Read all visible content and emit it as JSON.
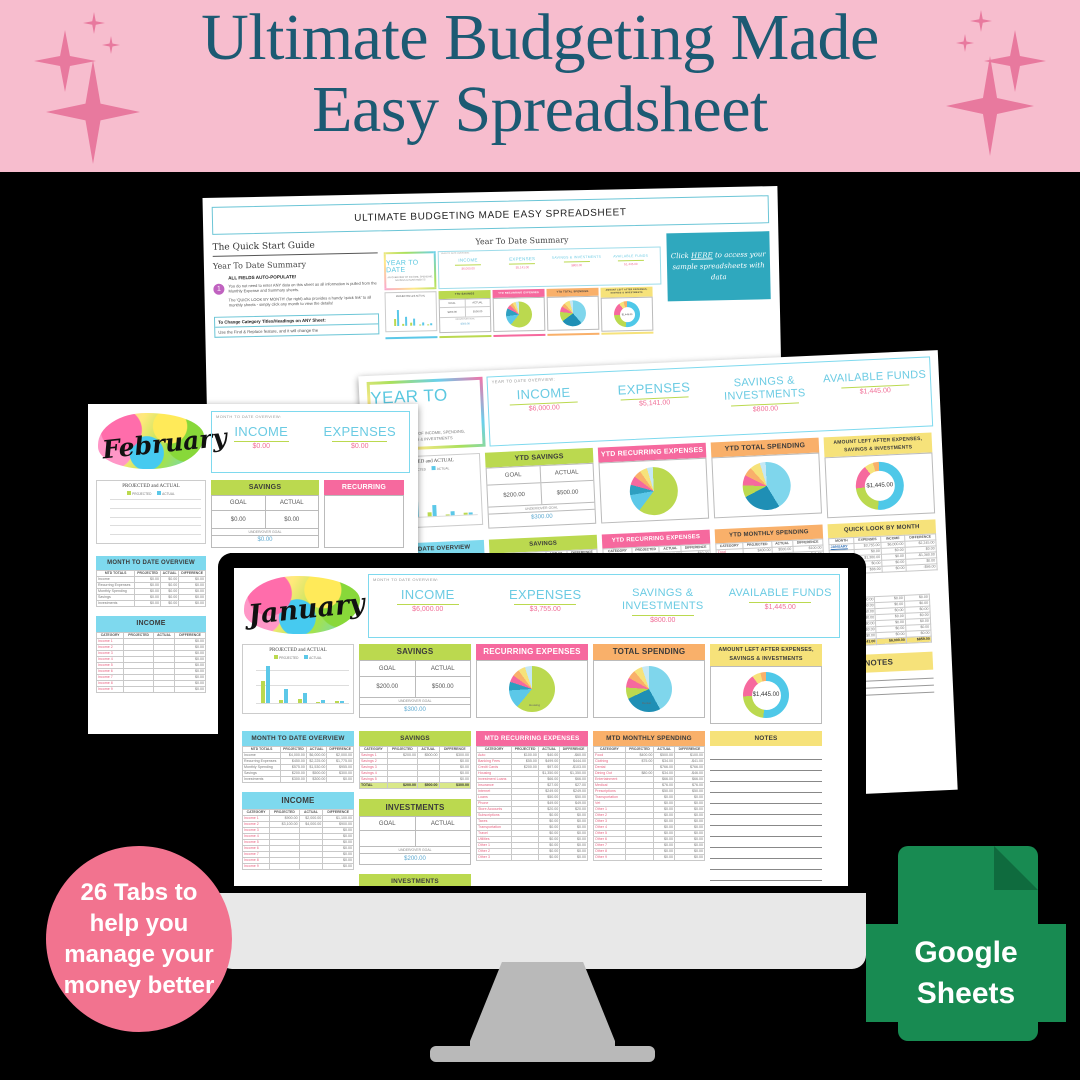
{
  "banner": {
    "title_line1": "Ultimate Budgeting Made",
    "title_line2": "Easy Spreadsheet",
    "bg_color": "#F7BDCE",
    "text_color": "#1C5A73",
    "sparkle_color": "#E8799E"
  },
  "badges": {
    "tabs_text": "26 Tabs to help you manage your money better",
    "tabs_bg": "#F2738F",
    "google_sheets_line1": "Google",
    "google_sheets_line2": "Sheets",
    "google_sheets_bg": "#188B52"
  },
  "quick_start": {
    "doc_title": "ULTIMATE BUDGETING MADE EASY SPREADSHEET",
    "heading": "The Quick Start Guide",
    "subheading": "Year To Date Summary",
    "step_number": "1",
    "bold_lead": "ALL FIELDS AUTO-POPULATE!",
    "para1": "You do not need to enter ANY data on this sheet as all information is pulled from the Monthly Expense and Summary sheets.",
    "para2": "The 'QUICK LOOK BY MONTH' (far right) also provides a handy 'quick link' to all monthly sheets - simply click any month to view the details!",
    "note_title": "To Change Category Titles/Headings on ANY Sheet:",
    "note_body": "Use the Find & Replace feature, and it will change the",
    "preview_caption": "Year To Date Summary",
    "callout_pre": "Click ",
    "callout_link": "HERE",
    "callout_post": " to access your sample spreadsheets with data",
    "callout_bg": "#2FA8BE"
  },
  "ytd_sheet": {
    "logo_title": "YEAR TO DATE",
    "logo_sub": "AN OVERVIEW OF INCOME, SPENDING, SAVINGS & INVESTMENTS",
    "overview_label": "YEAR TO DATE  OVERVIEW:",
    "kpis": [
      {
        "label": "INCOME",
        "value": "$6,000.00"
      },
      {
        "label": "EXPENSES",
        "value": "$5,141.00"
      },
      {
        "label": "SAVINGS & INVESTMENTS",
        "value": "$800.00"
      },
      {
        "label": "AVAILABLE FUNDS",
        "value": "$1,445.00"
      }
    ],
    "chart_title": "PROJECTED and ACTUAL",
    "legend": [
      "PROJECTED",
      "ACTUAL"
    ],
    "cards": [
      {
        "title": "YTD SAVINGS",
        "color": "#BBD94F"
      },
      {
        "title": "YTD RECURRING  EXPENSES",
        "color": "#F6699E"
      },
      {
        "title": "YTD TOTAL SPENDING",
        "color": "#F9B06A"
      },
      {
        "title": "AMOUNT LEFT AFTER EXPENSES, SAVINGS & INVESTMENTS",
        "color": "#F6E27A"
      }
    ],
    "savings_goal_label": "GOAL",
    "savings_actual_label": "ACTUAL",
    "savings_goal": "$200.00",
    "savings_actual": "$500.00",
    "under_over_label": "UNDER/OVER GOAL",
    "under_over_value": "$300.00",
    "donut_center": "$1,445.00",
    "tables": [
      {
        "title": "YEAR TO DATE OVERVIEW",
        "color": "#7ED9EE",
        "headers": [
          "YTD TOTALS",
          "PROJECTED",
          "ACTUAL",
          "DIFFERENCE"
        ]
      },
      {
        "title": "SAVINGS",
        "color": "#BBD94F",
        "headers": [
          "CATEGORY",
          "PROJECTED",
          "ACTUAL",
          "DIFFERENCE"
        ]
      },
      {
        "title": "YTD RECURRING  EXPENSES",
        "color": "#F6699E",
        "headers": [
          "CATEGORY",
          "PROJECTED",
          "ACTUAL",
          "DIFFERENCE"
        ]
      },
      {
        "title": "YTD MONTHLY SPENDING",
        "color": "#F9B06A",
        "headers": [
          "CATEGORY",
          "PROJECTED",
          "ACTUAL",
          "DIFFERENCE"
        ]
      },
      {
        "title": "QUICK LOOK BY MONTH",
        "color": "#F6E27A",
        "headers": [
          "MONTH",
          "EXPENSES",
          "INCOME",
          "DIFFERENCE"
        ]
      }
    ],
    "quick_look_rows": [
      [
        "JANUARY",
        "$3,755.00",
        "$6,000.00",
        "$2,245.00"
      ],
      [
        "",
        "$0.00",
        "$0.00",
        "$0.00"
      ],
      [
        "",
        "$1,380.00",
        "$0.00",
        "-$1,380.00"
      ],
      [
        "",
        "$0.00",
        "$0.00",
        "$0.00"
      ],
      [
        "",
        "$86.00",
        "$0.00",
        "-$86.00"
      ],
      [
        "",
        "$0.00",
        "$0.00",
        "$0.00"
      ],
      [
        "",
        "$0.00",
        "$0.00",
        "$0.00"
      ],
      [
        "",
        "$0.00",
        "$0.00",
        "$0.00"
      ],
      [
        "",
        "$0.00",
        "$0.00",
        "$0.00"
      ],
      [
        "",
        "$0.00",
        "$0.00",
        "$0.00"
      ],
      [
        "",
        "$0.00",
        "$0.00",
        "$0.00"
      ],
      [
        "",
        "$0.00",
        "$0.00",
        "$0.00"
      ]
    ],
    "quick_look_total": [
      "TOTAL",
      "$5,141.00",
      "$6,000.00",
      "$859.00"
    ],
    "notes_title": "NOTES"
  },
  "january_sheet": {
    "month": "January",
    "overview_label": "MONTH  TO  DATE  OVERVIEW:",
    "kpis": [
      {
        "label": "INCOME",
        "value": "$6,000.00"
      },
      {
        "label": "EXPENSES",
        "value": "$3,755.00"
      },
      {
        "label": "SAVINGS & INVESTMENTS",
        "value": "$800.00"
      },
      {
        "label": "AVAILABLE FUNDS",
        "value": "$1,445.00"
      }
    ],
    "chart_title": "PROJECTED and ACTUAL",
    "legend": [
      "PROJECTED",
      "ACTUAL"
    ],
    "cards": [
      {
        "title": "SAVINGS",
        "color": "#BBD94F"
      },
      {
        "title": "RECURRING  EXPENSES",
        "color": "#F6699E"
      },
      {
        "title": "TOTAL SPENDING",
        "color": "#F9B06A"
      },
      {
        "title": "AMOUNT LEFT AFTER EXPENSES, SAVINGS & INVESTMENTS",
        "color": "#F6E27A"
      }
    ],
    "savings_goal_label": "GOAL",
    "savings_actual_label": "ACTUAL",
    "savings_goal": "$200.00",
    "savings_actual": "$500.00",
    "under_over_label": "UNDER/OVER GOAL",
    "under_over_value": "$300.00",
    "donut_center": "$1,445.00",
    "pie_labels": [
      "Housing",
      "Food",
      "Dental",
      "Credit Card",
      "Parking Fee"
    ],
    "tables": [
      {
        "title": "MONTH TO DATE OVERVIEW",
        "color": "#7ED9EE",
        "headers": [
          "MTD TOTALS",
          "PROJECTED",
          "ACTUAL",
          "DIFFERENCE"
        ]
      },
      {
        "title": "SAVINGS",
        "color": "#BBD94F",
        "headers": [
          "CATEGORY",
          "PROJECTED",
          "ACTUAL",
          "DIFFERENCE"
        ]
      },
      {
        "title": "MTD RECURRING  EXPENSES",
        "color": "#F6699E",
        "headers": [
          "CATEGORY",
          "PROJECTED",
          "ACTUAL",
          "DIFFERENCE"
        ]
      },
      {
        "title": "MTD MONTHLY SPENDING",
        "color": "#F9B06A",
        "headers": [
          "CATEGORY",
          "PROJECTED",
          "ACTUAL",
          "DIFFERENCE"
        ]
      },
      {
        "title": "NOTES",
        "color": "#F6E27A",
        "headers": []
      }
    ],
    "mtd_overview_rows": [
      [
        "Income",
        "$4,000.00",
        "$6,000.00",
        "$2,000.00"
      ],
      [
        "Recurring Expenses",
        "$450.00",
        "$2,225.00",
        "$1,775.00"
      ],
      [
        "Monthly Spending",
        "$575.00",
        "$1,530.00",
        "$955.00"
      ],
      [
        "Savings",
        "$200.00",
        "$500.00",
        "$300.00"
      ],
      [
        "Investments",
        "$300.00",
        "$300.00",
        "$0.00"
      ]
    ],
    "income_title": "INCOME",
    "income_headers": [
      "CATEGORY",
      "PROJECTED",
      "ACTUAL",
      "DIFFERENCE"
    ],
    "income_rows": [
      [
        "Income 1",
        "$900.00",
        "$2,000.00",
        "$1,100.00"
      ],
      [
        "Income 2",
        "$3,100.00",
        "$4,000.00",
        "$900.00"
      ],
      [
        "Income 3",
        "",
        "",
        "$0.00"
      ],
      [
        "Income 4",
        "",
        "",
        "$0.00"
      ],
      [
        "Income 5",
        "",
        "",
        "$0.00"
      ],
      [
        "Income 6",
        "",
        "",
        "$0.00"
      ],
      [
        "Income 7",
        "",
        "",
        "$0.00"
      ],
      [
        "Income 8",
        "",
        "",
        "$0.00"
      ],
      [
        "Income 9",
        "",
        "",
        "$0.00"
      ]
    ],
    "savings_rows": [
      [
        "Savings 1",
        "$200.00",
        "$500.00",
        "$300.00"
      ],
      [
        "Savings 2",
        "",
        "",
        "$0.00"
      ],
      [
        "Savings 3",
        "",
        "",
        "$0.00"
      ],
      [
        "Savings 4",
        "",
        "",
        "$0.00"
      ],
      [
        "Savings 5",
        "",
        "",
        "$0.00"
      ]
    ],
    "savings_total_row": [
      "TOTAL",
      "$200.00",
      "$500.00",
      "$300.00"
    ],
    "investments_title": "INVESTMENTS",
    "investments_goal_label": "GOAL",
    "investments_actual_label": "ACTUAL",
    "investments_under_label": "UNDER/OVER GOAL",
    "investments_under_value": "$200.00",
    "investments_table_title": "INVESTMENTS",
    "recurring_rows": [
      [
        "Auto",
        "$100.00",
        "$40.00",
        "-$60.00"
      ],
      [
        "Banking Fees",
        "$55.00",
        "$499.00",
        "$444.00"
      ],
      [
        "Credit Cards",
        "$200.00",
        "$97.00",
        "-$103.00"
      ],
      [
        "Housing",
        "",
        "$1,350.00",
        "$1,350.00"
      ],
      [
        "Investment Loans",
        "",
        "$66.00",
        "$66.00"
      ],
      [
        "Insurance",
        "",
        "$27.00",
        "$27.00"
      ],
      [
        "Internet",
        "",
        "$249.00",
        "$249.00"
      ],
      [
        "Loans",
        "",
        "$50.00",
        "$50.00"
      ],
      [
        "Phone",
        "",
        "$49.00",
        "$49.00"
      ],
      [
        "Store Accounts",
        "",
        "$20.00",
        "$20.00"
      ],
      [
        "Subscriptions",
        "",
        "$0.00",
        "$0.00"
      ],
      [
        "Taxes",
        "",
        "$0.00",
        "$0.00"
      ],
      [
        "Transportation",
        "",
        "$0.00",
        "$0.00"
      ],
      [
        "Travel",
        "",
        "$0.00",
        "$0.00"
      ],
      [
        "Utilities",
        "",
        "$0.00",
        "$0.00"
      ],
      [
        "Other 1",
        "",
        "$0.00",
        "$0.00"
      ],
      [
        "Other 2",
        "",
        "$0.00",
        "$0.00"
      ],
      [
        "Other 3",
        "",
        "$0.00",
        "$0.00"
      ]
    ],
    "spending_rows": [
      [
        "Food",
        "$400.00",
        "$500.00",
        "$100.00"
      ],
      [
        "Clothing",
        "$75.00",
        "$34.00",
        "-$41.00"
      ],
      [
        "Dental",
        "",
        "$766.00",
        "$766.00"
      ],
      [
        "Dining Out",
        "$80.00",
        "$34.00",
        "-$46.00"
      ],
      [
        "Entertainment",
        "",
        "$66.00",
        "$66.00"
      ],
      [
        "Medical",
        "",
        "$76.00",
        "$76.00"
      ],
      [
        "Prescriptions",
        "",
        "$50.00",
        "$50.00"
      ],
      [
        "Transportation",
        "",
        "$0.00",
        "$0.00"
      ],
      [
        "Vet",
        "",
        "$0.00",
        "$0.00"
      ],
      [
        "Other 1",
        "",
        "$0.00",
        "$0.00"
      ],
      [
        "Other 2",
        "",
        "$0.00",
        "$0.00"
      ],
      [
        "Other 3",
        "",
        "$0.00",
        "$0.00"
      ],
      [
        "Other 4",
        "",
        "$0.00",
        "$0.00"
      ],
      [
        "Other 5",
        "",
        "$0.00",
        "$0.00"
      ],
      [
        "Other 6",
        "",
        "$0.00",
        "$0.00"
      ],
      [
        "Other 7",
        "",
        "$0.00",
        "$0.00"
      ],
      [
        "Other 8",
        "",
        "$0.00",
        "$0.00"
      ],
      [
        "Other 9",
        "",
        "$0.00",
        "$0.00"
      ]
    ]
  },
  "february_sheet": {
    "month": "February",
    "overview_label": "MONTH  TO  DATE  OVERVIEW:",
    "kpis": [
      {
        "label": "INCOME",
        "value": "$0.00"
      },
      {
        "label": "EXPENSES",
        "value": "$0.00"
      }
    ],
    "chart_title": "PROJECTED and ACTUAL",
    "legend": [
      "PROJECTED",
      "ACTUAL"
    ],
    "savings_title": "SAVINGS",
    "recurring_title": "RECURRING",
    "savings_goal_label": "GOAL",
    "savings_actual_label": "ACTUAL",
    "savings_goal": "$0.00",
    "savings_actual": "$0.00",
    "under_over_label": "UNDER/OVER GOAL",
    "under_over_value": "$0.00",
    "overview_table_title": "MONTH TO DATE OVERVIEW",
    "overview_headers": [
      "MTD TOTALS",
      "PROJECTED",
      "ACTUAL",
      "DIFFERENCE"
    ],
    "overview_rows": [
      [
        "Income",
        "$0.00",
        "$0.00",
        "$0.00"
      ],
      [
        "Recurring Expenses",
        "$0.00",
        "$0.00",
        "$0.00"
      ],
      [
        "Monthly Spending",
        "$0.00",
        "$0.00",
        "$0.00"
      ],
      [
        "Savings",
        "$0.00",
        "$0.00",
        "$0.00"
      ],
      [
        "Investments",
        "$0.00",
        "$0.00",
        "$0.00"
      ]
    ],
    "income_title": "INCOME",
    "income_headers": [
      "CATEGORY",
      "PROJECTED",
      "ACTUAL",
      "DIFFERENCE"
    ],
    "income_rows": [
      [
        "Income 1",
        "",
        "",
        "$0.00"
      ],
      [
        "Income 2",
        "",
        "",
        "$0.00"
      ],
      [
        "Income 3",
        "",
        "",
        "$0.00"
      ],
      [
        "Income 4",
        "",
        "",
        "$0.00"
      ],
      [
        "Income 5",
        "",
        "",
        "$0.00"
      ],
      [
        "Income 6",
        "",
        "",
        "$0.00"
      ],
      [
        "Income 7",
        "",
        "",
        "$0.00"
      ],
      [
        "Income 8",
        "",
        "",
        "$0.00"
      ],
      [
        "Income 9",
        "",
        "",
        "$0.00"
      ]
    ]
  },
  "chart_data": [
    {
      "type": "bar",
      "title": "PROJECTED and ACTUAL",
      "categories": [
        "Income",
        "Recurring Expenses",
        "Monthly Spending",
        "Savings",
        "Investments"
      ],
      "series": [
        {
          "name": "PROJECTED",
          "values": [
            4000,
            450,
            575,
            200,
            300
          ]
        },
        {
          "name": "ACTUAL",
          "values": [
            6000,
            2225,
            1530,
            500,
            300
          ]
        }
      ],
      "ylabel": "",
      "xlabel": "",
      "ylim": [
        0,
        6000
      ],
      "legend_position": "top",
      "colors": [
        "#BBD94F",
        "#5CC8E8"
      ]
    },
    {
      "type": "pie",
      "title": "RECURRING  EXPENSES",
      "categories": [
        "Housing",
        "Credit Cards",
        "Banking Fees",
        "Auto",
        "Insurance",
        "Internet",
        "Investment Loans",
        "Phone"
      ],
      "values": [
        60.7,
        12.2,
        10.1,
        4.4,
        3.7,
        3.1,
        3.0,
        2.8
      ],
      "colors": [
        "#BBD94F",
        "#5CC8E8",
        "#2E9FC0",
        "#F6699E",
        "#F9B06A",
        "#F6E27A",
        "#C5E8F5",
        "#E8E8E8"
      ]
    },
    {
      "type": "pie",
      "title": "TOTAL SPENDING",
      "categories": [
        "Dental",
        "Food",
        "Clothing",
        "Dining Out",
        "Entertainment",
        "Medical",
        "Prescriptions",
        "Other"
      ],
      "values": [
        39.0,
        26.0,
        12.0,
        7.0,
        5.0,
        4.0,
        4.0,
        3.0
      ],
      "colors": [
        "#7FD6EC",
        "#1F8FB5",
        "#BBD94F",
        "#F6699E",
        "#F9B06A",
        "#F6E27A",
        "#C5E8F5",
        "#E8E8E8"
      ]
    },
    {
      "type": "pie",
      "title": "AMOUNT LEFT AFTER EXPENSES, SAVINGS & INVESTMENTS",
      "center_label": "$1,445.00",
      "categories": [
        "Available Funds",
        "Recurring Expenses",
        "Monthly Spending",
        "Savings",
        "Investments"
      ],
      "values": [
        52.0,
        22.0,
        16.0,
        6.0,
        4.0
      ],
      "colors": [
        "#4FC8E8",
        "#BBD94F",
        "#F6699E",
        "#F6E27A",
        "#F9B06A"
      ]
    }
  ]
}
